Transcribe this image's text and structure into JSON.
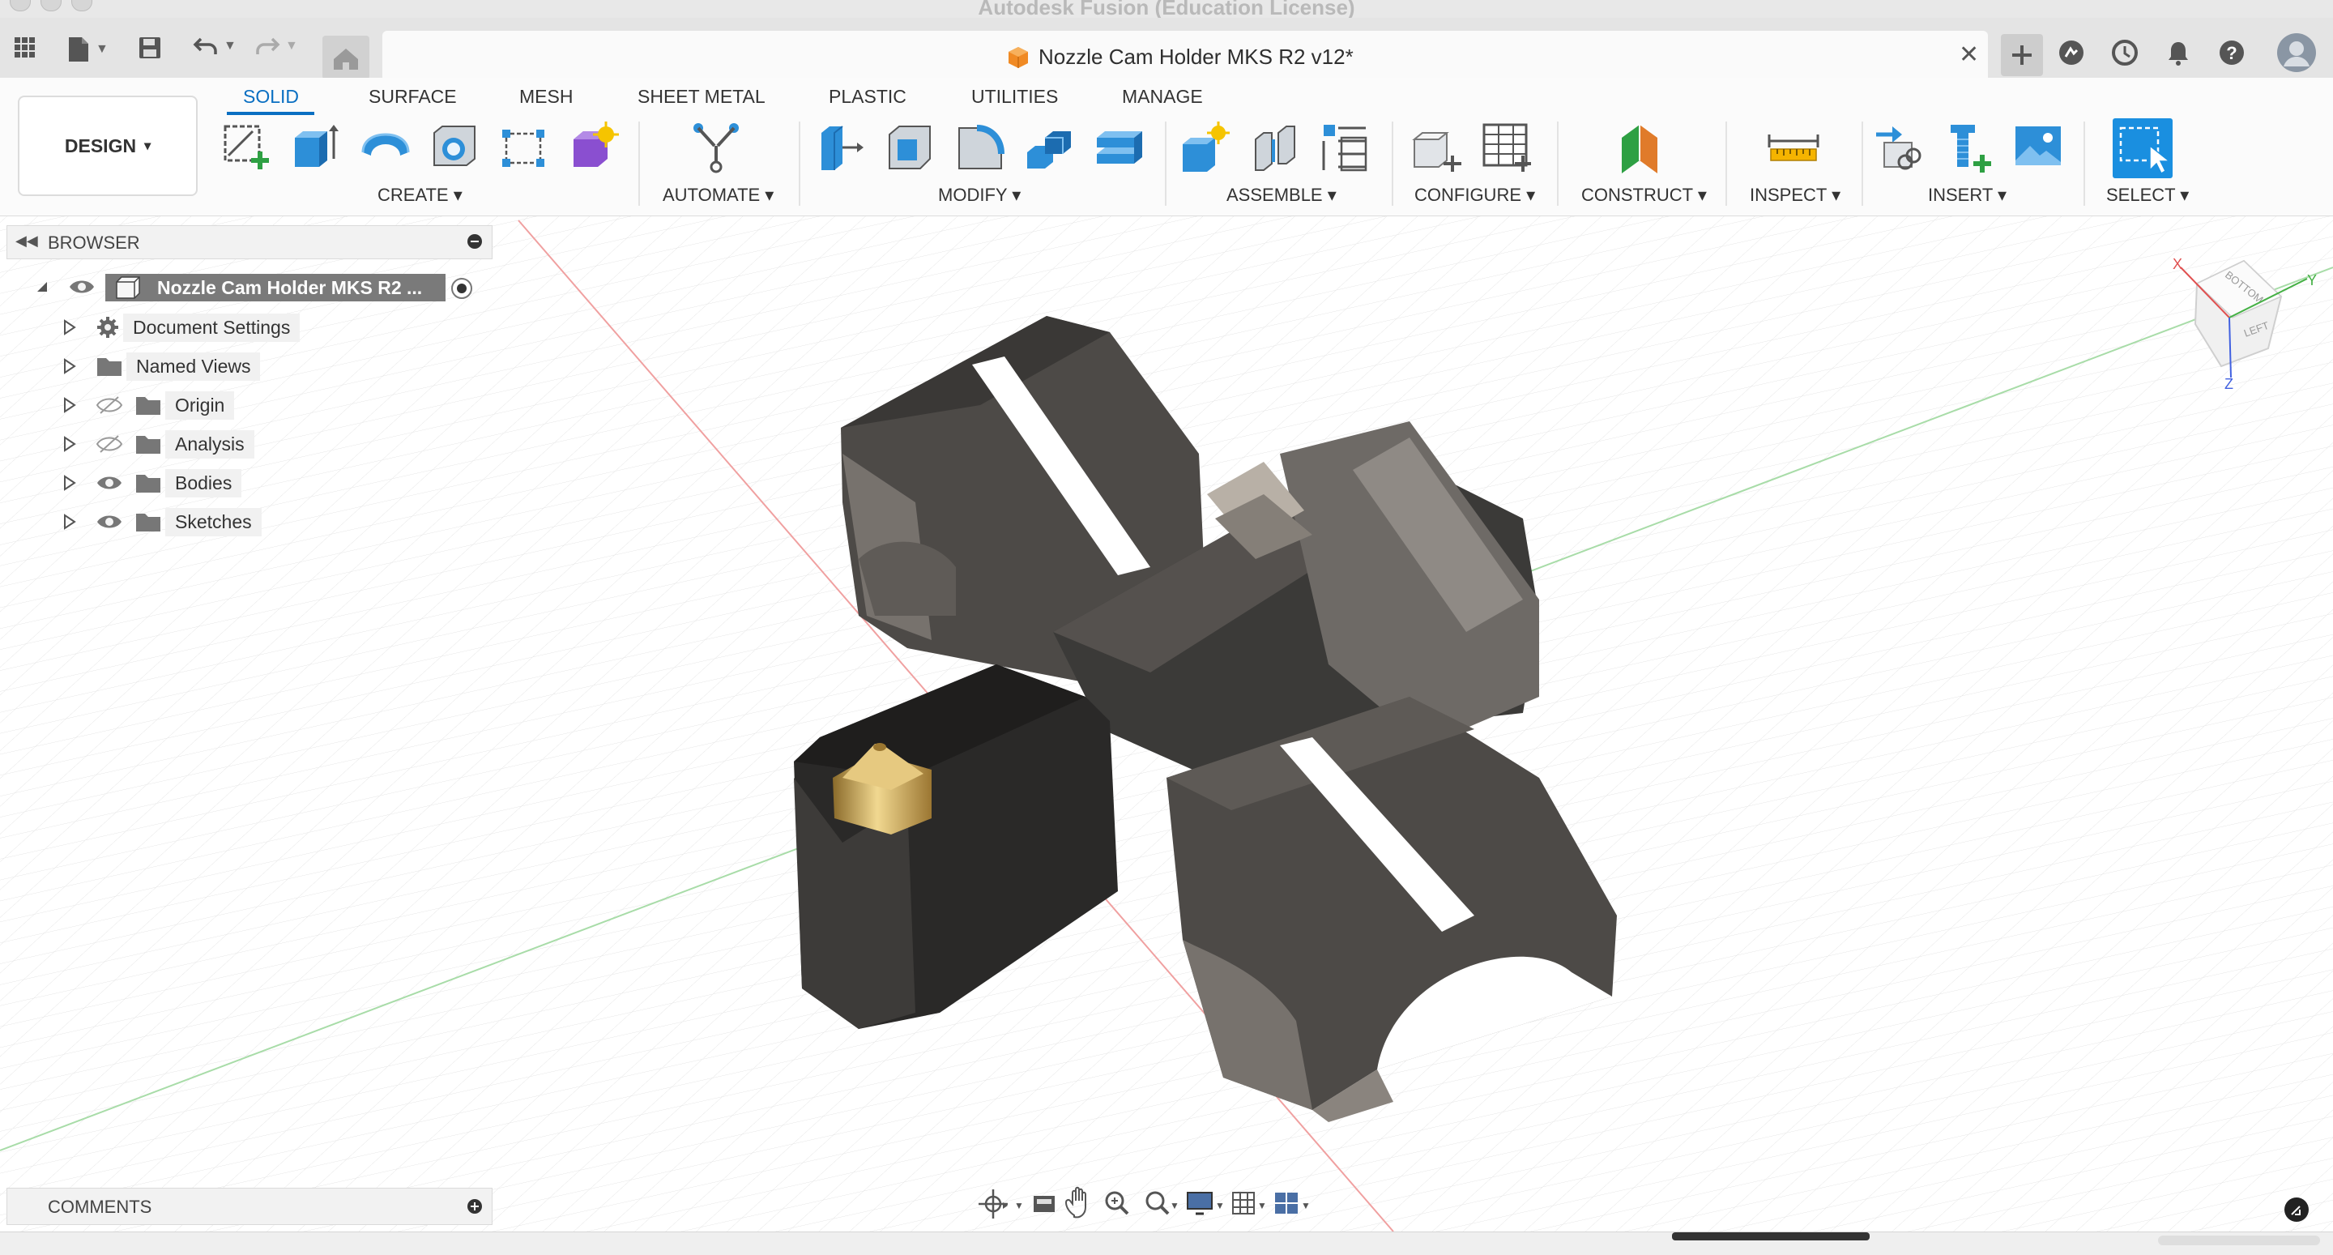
{
  "window": {
    "title": "Autodesk Fusion (Education License)"
  },
  "document_tab": {
    "title": "Nozzle Cam Holder MKS R2 v12*",
    "close_glyph": "✕"
  },
  "workspace": {
    "label": "DESIGN",
    "caret": "▾"
  },
  "tabs": [
    {
      "label": "SOLID",
      "active": true
    },
    {
      "label": "SURFACE"
    },
    {
      "label": "MESH"
    },
    {
      "label": "SHEET METAL"
    },
    {
      "label": "PLASTIC"
    },
    {
      "label": "UTILITIES"
    },
    {
      "label": "MANAGE"
    }
  ],
  "tool_groups": [
    {
      "label": "CREATE ▾"
    },
    {
      "label": "AUTOMATE ▾"
    },
    {
      "label": "MODIFY ▾"
    },
    {
      "label": "ASSEMBLE ▾"
    },
    {
      "label": "CONFIGURE ▾"
    },
    {
      "label": "CONSTRUCT ▾"
    },
    {
      "label": "INSPECT ▾"
    },
    {
      "label": "INSERT ▾"
    },
    {
      "label": "SELECT ▾"
    }
  ],
  "browser": {
    "title": "BROWSER",
    "root": "Nozzle Cam Holder MKS R2 ...",
    "items": [
      {
        "label": "Document Settings",
        "icon": "gear-icon"
      },
      {
        "label": "Named Views",
        "icon": "folder-icon"
      },
      {
        "label": "Origin",
        "icon": "folder-icon",
        "visible": false
      },
      {
        "label": "Analysis",
        "icon": "folder-icon",
        "visible": false
      },
      {
        "label": "Bodies",
        "icon": "folder-icon",
        "visible": true
      },
      {
        "label": "Sketches",
        "icon": "folder-icon",
        "visible": true
      }
    ]
  },
  "comments": {
    "title": "COMMENTS"
  },
  "viewcube": {
    "top": "BOTTOM",
    "side": "LEFT",
    "x_axis": "X",
    "y_axis": "Y",
    "z_axis": "Z"
  },
  "colors": {
    "accent": "#0a6fc2",
    "model": "#4a4744",
    "nozzle": "#c9a24f"
  }
}
